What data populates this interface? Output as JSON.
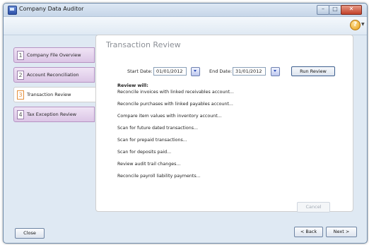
{
  "window": {
    "title": "Company Data Auditor",
    "min_glyph": "–",
    "max_glyph": "□",
    "close_glyph": "✕"
  },
  "toolbar": {
    "help_glyph": "?",
    "help_menu_glyph": "▼"
  },
  "sidebar": {
    "items": [
      {
        "number": "1",
        "label": "Company File Overview"
      },
      {
        "number": "2",
        "label": "Account Reconciliation"
      },
      {
        "number": "3",
        "label": "Transaction Review"
      },
      {
        "number": "4",
        "label": "Tax Exception Review"
      }
    ]
  },
  "main": {
    "title": "Transaction Review",
    "start_date_label": "Start Date:",
    "start_date_value": "01/01/2012",
    "end_date_label": "End Date:",
    "end_date_value": "31/01/2012",
    "run_review_label": "Run Review",
    "review_heading": "Review will:",
    "review_items": [
      "Reconcile invoices with linked receivables account...",
      "Reconcile purchases with linked payables account...",
      "Compare item values with inventory account...",
      "Scan for future dated transactions...",
      "Scan for prepaid transactions...",
      "Scan for deposits paid...",
      "Review audit trail changes...",
      "Reconcile payroll liability payments..."
    ],
    "cancel_label": "Cancel"
  },
  "footer": {
    "close_label": "Close",
    "back_label": "< Back",
    "next_label": "Next >"
  }
}
